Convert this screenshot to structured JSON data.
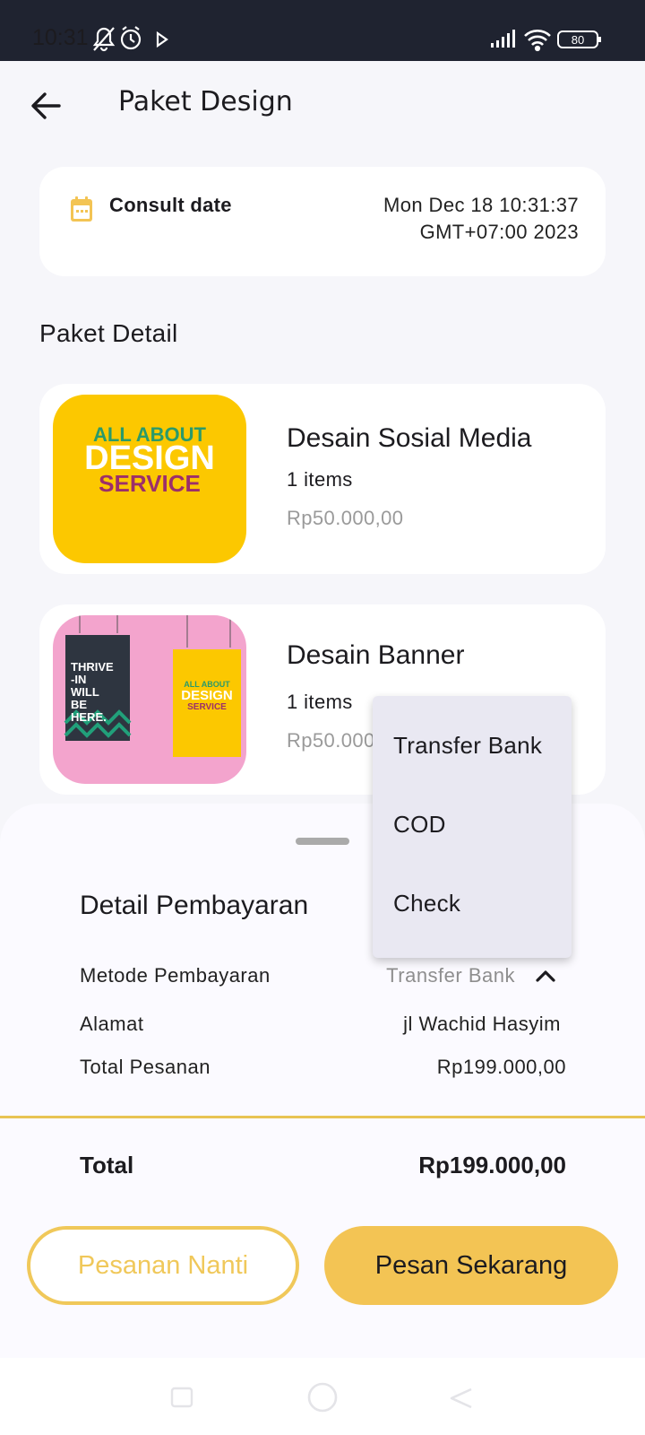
{
  "status_bar": {
    "time": "10:31",
    "battery": "80",
    "left_icons": [
      "bell-off-icon",
      "alarm-icon",
      "play-store-icon"
    ],
    "right_icons": [
      "signal-icon",
      "wifi-icon",
      "battery-icon"
    ]
  },
  "app_bar": {
    "title": "Paket Design",
    "back_icon": "arrow-left-icon"
  },
  "consult": {
    "icon": "calendar-icon",
    "label": "Consult date",
    "value_line1": "Mon Dec 18 10:31:37",
    "value_line2": "GMT+07:00 2023",
    "accent": "#f3c454"
  },
  "section": {
    "title": "Paket Detail"
  },
  "products": [
    {
      "name": "Desain Sosial Media",
      "qty": "1 items",
      "price": "Rp50.000,00",
      "thumb_text": [
        "ALL ABOUT",
        "DESIGN",
        "SERVICE"
      ]
    },
    {
      "name": "Desain Banner",
      "qty": "1 items",
      "price": "Rp50.000,00",
      "thumb_text_left": [
        "THRIVE",
        "-IN",
        "WILL",
        "BE",
        "HERE."
      ],
      "thumb_text_right": [
        "ALL ABOUT",
        "DESIGN",
        "SERVICE"
      ]
    }
  ],
  "payment": {
    "title": "Detail Pembayaran",
    "method_label": "Metode Pembayaran",
    "method_value": "Transfer Bank",
    "address_label": "Alamat",
    "address_value": "jl Wachid Hasyim",
    "order_total_label": "Total Pesanan",
    "order_total_value": "Rp199.000,00",
    "total_label": "Total",
    "total_value": "Rp199.000,00"
  },
  "dropdown": {
    "options": [
      "Transfer Bank",
      "COD",
      "Check"
    ]
  },
  "buttons": {
    "later": "Pesanan Nanti",
    "now": "Pesan Sekarang"
  },
  "colors": {
    "accent": "#f3c454",
    "status_bar": "#1f2330",
    "background": "#f6f6fa"
  }
}
